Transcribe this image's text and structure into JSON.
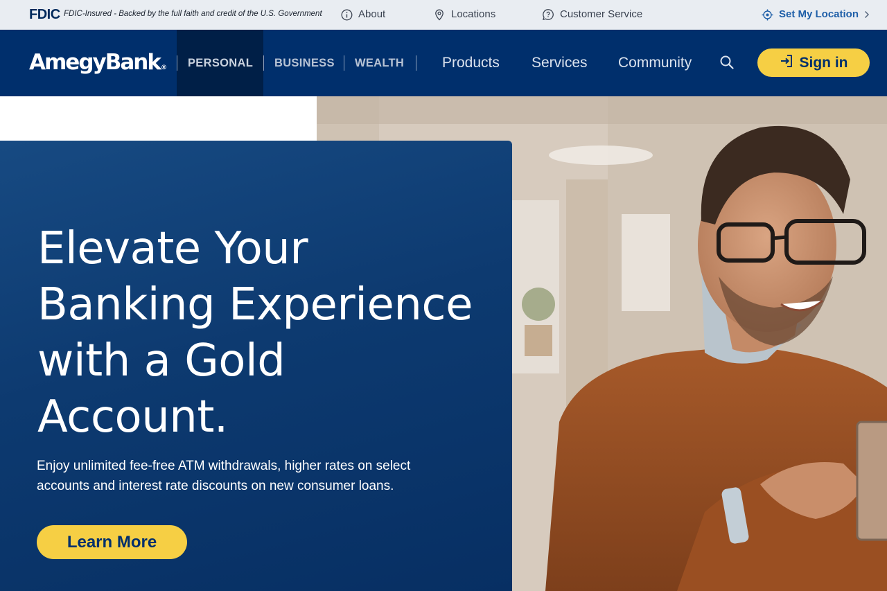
{
  "utility_bar": {
    "fdic_logo": "FDIC",
    "fdic_text": "FDIC-Insured - Backed by the full faith and credit of the U.S. Government",
    "about": "About",
    "locations": "Locations",
    "customer_service": "Customer Service",
    "set_location": "Set My Location"
  },
  "nav": {
    "brand": "AmegyBank",
    "brand_mark": "®",
    "segments": [
      "PERSONAL",
      "BUSINESS",
      "WEALTH"
    ],
    "active_segment": "PERSONAL",
    "links": [
      "Products",
      "Services",
      "Community"
    ],
    "sign_in": "Sign in"
  },
  "hero": {
    "title": "Elevate Your Banking Experience with a Gold Account.",
    "description": "Enjoy unlimited fee-free ATM withdrawals, higher rates on select accounts and interest rate discounts on new consumer loans.",
    "cta": "Learn More"
  },
  "colors": {
    "navy": "#002f6c",
    "accent_yellow": "#f6cf44",
    "utility_bg": "#e9edf2",
    "link_blue": "#1f5fa8"
  },
  "icons": [
    "info-icon",
    "map-pin-icon",
    "chat-bubble-icon",
    "crosshair-location-icon",
    "chevron-right-icon",
    "search-icon",
    "sign-in-arrow-icon"
  ]
}
